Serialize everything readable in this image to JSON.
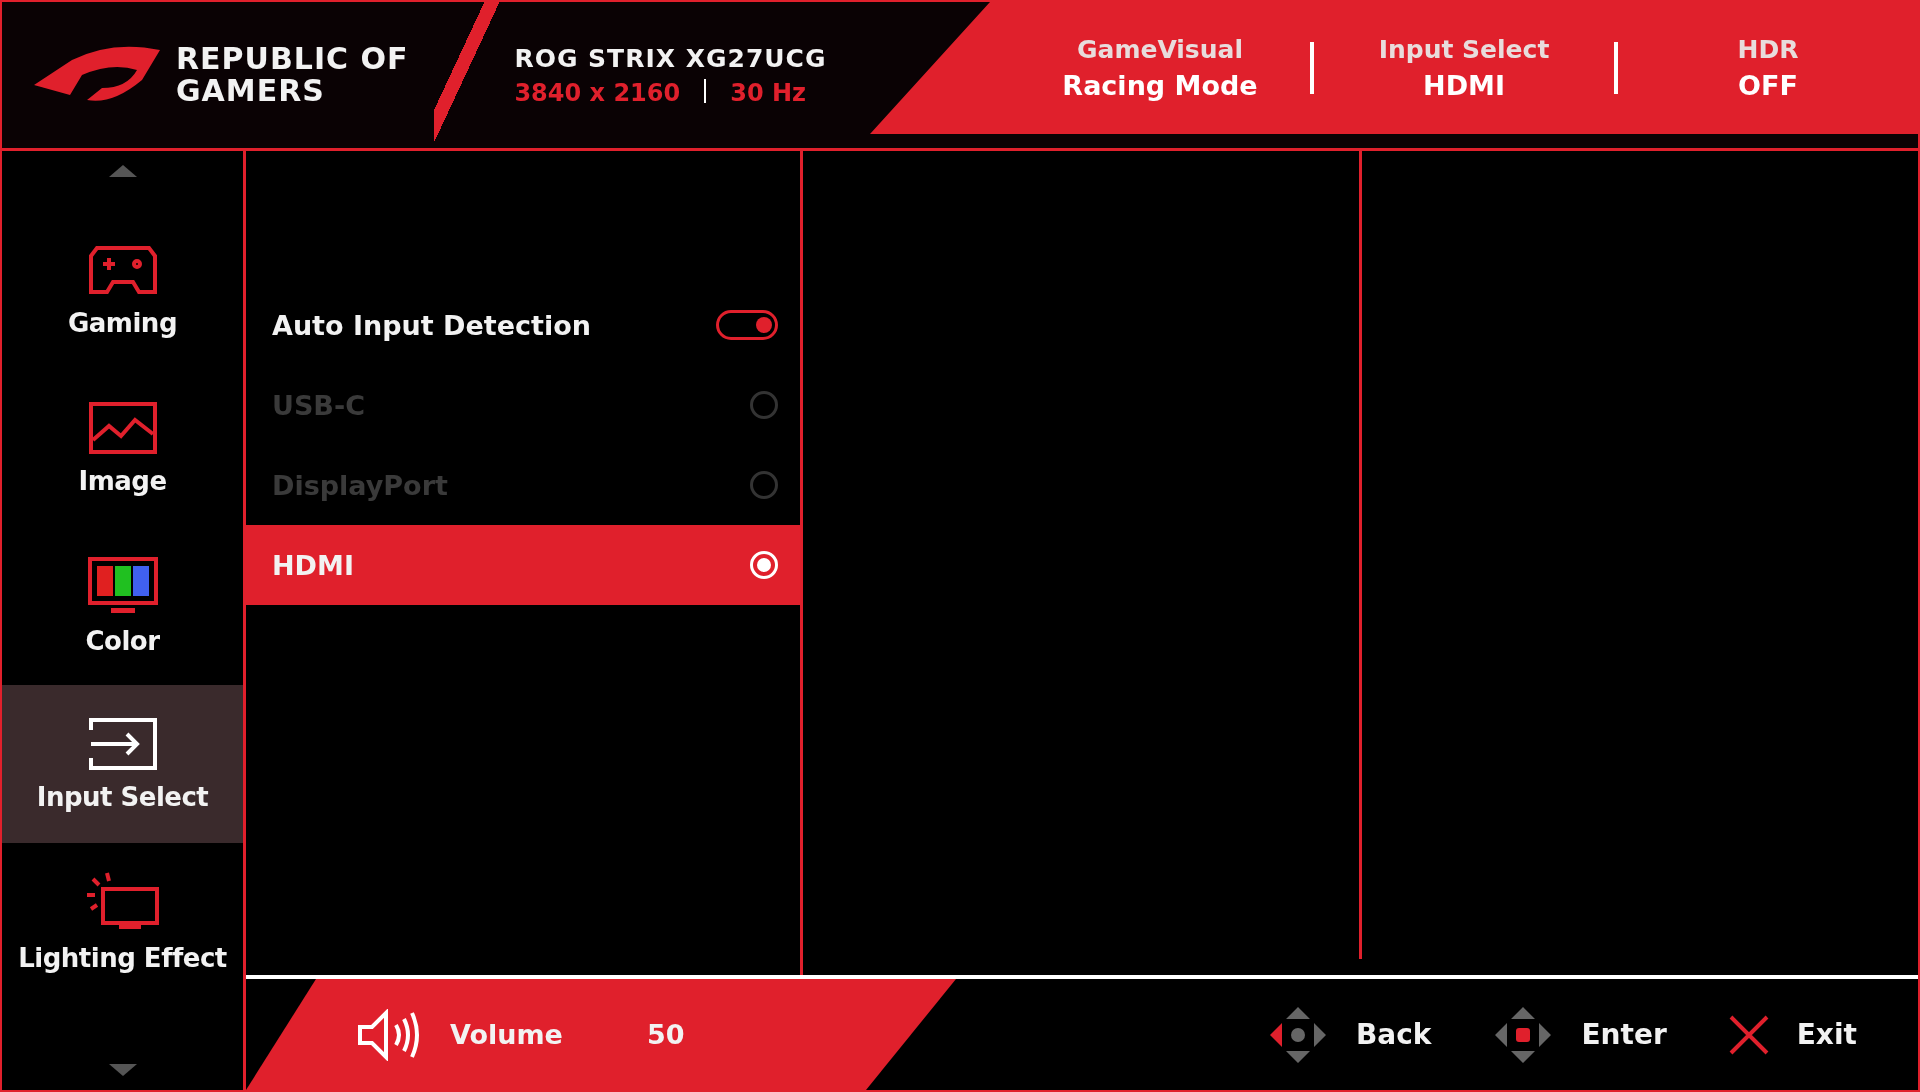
{
  "header": {
    "logo_lines": [
      "REPUBLIC OF",
      "GAMERS"
    ],
    "model": "ROG STRIX XG27UCG",
    "resolution": "3840 x 2160",
    "refresh_rate": "30 Hz",
    "status": [
      {
        "label": "GameVisual",
        "value": "Racing Mode"
      },
      {
        "label": "Input Select",
        "value": "HDMI"
      },
      {
        "label": "HDR",
        "value": "OFF"
      }
    ]
  },
  "sidebar": {
    "items": [
      {
        "label": "Gaming",
        "selected": false
      },
      {
        "label": "Image",
        "selected": false
      },
      {
        "label": "Color",
        "selected": false
      },
      {
        "label": "Input Select",
        "selected": true
      },
      {
        "label": "Lighting Effect",
        "selected": false
      }
    ]
  },
  "menu": {
    "rows": [
      {
        "kind": "toggle",
        "label": "Auto Input Detection",
        "on": true
      },
      {
        "kind": "radio",
        "label": "USB-C",
        "selected": false,
        "disabled": true
      },
      {
        "kind": "radio",
        "label": "DisplayPort",
        "selected": false,
        "disabled": true
      },
      {
        "kind": "radio",
        "label": "HDMI",
        "selected": true,
        "disabled": false
      }
    ]
  },
  "footer": {
    "volume": {
      "label": "Volume",
      "value": "50"
    },
    "hints": [
      {
        "label": "Back"
      },
      {
        "label": "Enter"
      },
      {
        "label": "Exit"
      }
    ]
  }
}
